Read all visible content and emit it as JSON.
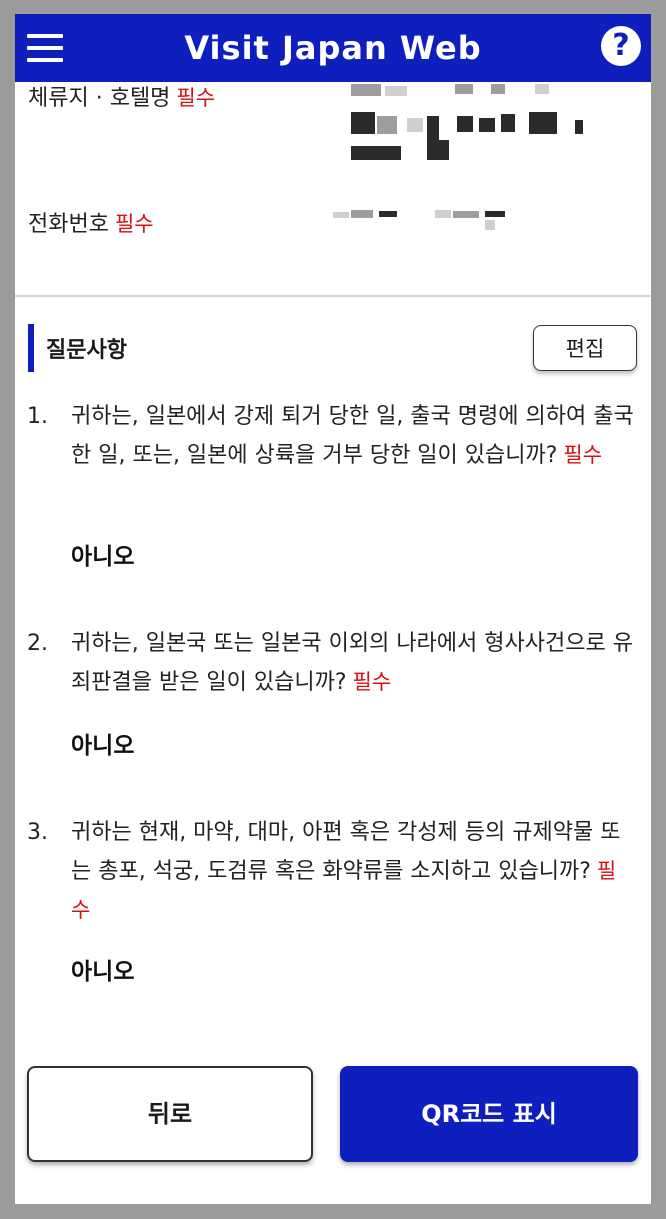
{
  "header": {
    "title": "Visit Japan Web",
    "help_label": "?"
  },
  "fields": [
    {
      "label": "체류지 · 호텔명",
      "required": "필수"
    },
    {
      "label": "전화번호",
      "required": "필수"
    }
  ],
  "section": {
    "title": "질문사항",
    "edit_label": "편집"
  },
  "questions": [
    {
      "number": "1.",
      "text": "귀하는, 일본에서 강제 퇴거 당한 일, 출국 명령에 의하여 출국한 일, 또는, 일본에 상륙을 거부 당한 일이 있습니까?",
      "required": "필수",
      "answer": "아니오"
    },
    {
      "number": "2.",
      "text": "귀하는, 일본국 또는 일본국 이외의 나라에서 형사사건으로 유죄판결을 받은 일이 있습니까?",
      "required": "필수",
      "answer": "아니오"
    },
    {
      "number": "3.",
      "text": "귀하는 현재, 마약, 대마, 아편 혹은 각성제 등의 규제약물 또는 총포, 석궁, 도검류 혹은 화약류를 소지하고 있습니까?",
      "required": "필수",
      "answer": "아니오"
    }
  ],
  "buttons": {
    "back_label": "뒤로",
    "qr_label": "QR코드 표시"
  },
  "colors": {
    "brand_blue": "#0f1fbd",
    "required_red": "#d51010"
  }
}
